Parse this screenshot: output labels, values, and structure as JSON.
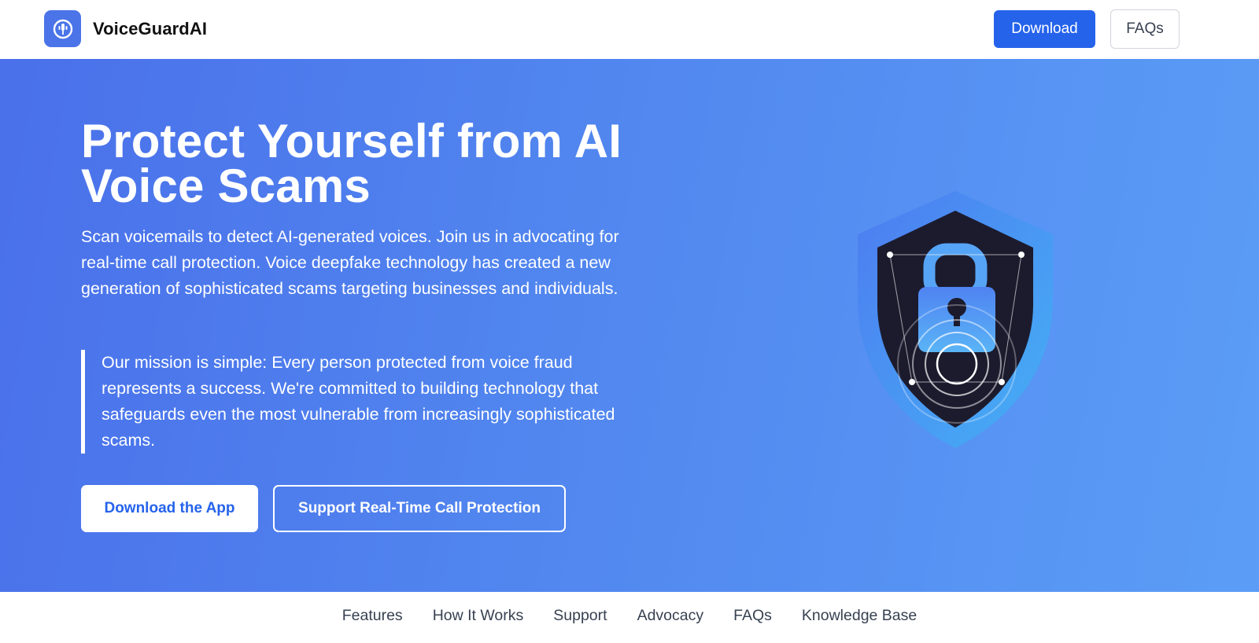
{
  "header": {
    "brand_name": "VoiceGuardAI",
    "logo_icon": "microphone-icon",
    "download_label": "Download",
    "faqs_label": "FAQs"
  },
  "hero": {
    "title": "Protect Yourself from AI Voice Scams",
    "description": "Scan voicemails to detect AI-generated voices. Join us in advocating for real-time call protection. Voice deepfake technology has created a new generation of sophisticated scams targeting businesses and individuals.",
    "mission": "Our mission is simple: Every person protected from voice fraud represents a success. We're committed to building technology that safeguards even the most vulnerable from increasingly sophisticated scams.",
    "primary_cta": "Download the App",
    "secondary_cta": "Support Real-Time Call Protection",
    "illustration": "shield-lock-icon"
  },
  "footer_nav": {
    "items": [
      "Features",
      "How It Works",
      "Support",
      "Advocacy",
      "FAQs",
      "Knowledge Base"
    ]
  },
  "colors": {
    "primary": "#2563eb",
    "hero_start": "#4a70ea",
    "hero_end": "#5b9df6",
    "shield_dark": "#1c1b2e"
  }
}
